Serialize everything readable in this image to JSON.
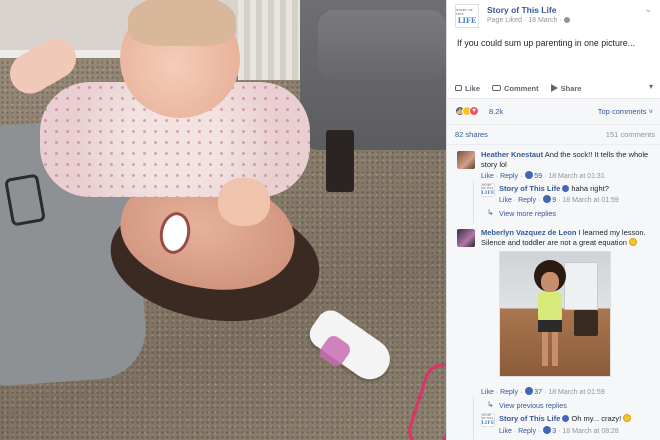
{
  "post": {
    "page_name": "Story of This Life",
    "avatar_line1": "STORY OF THIS",
    "avatar_line2": "LIFE",
    "meta": "Page Liked · 18 March ·",
    "text": "If you could sum up parenting in one picture...",
    "actions": {
      "like": "Like",
      "comment": "Comment",
      "share": "Share"
    }
  },
  "reactions": {
    "count": "8.2k",
    "top_comments": "Top comments ˅"
  },
  "stats": {
    "shares": "82 shares",
    "comments": "151 comments"
  },
  "comments": [
    {
      "author": "Heather Knestaut",
      "text_line1": "And the sock!! It tells the whole",
      "text_line2": "story lol",
      "like": "Like",
      "reply": "Reply",
      "likes": "59",
      "time": "18 March at 01:31",
      "reply_item": {
        "author": "Story of This Life",
        "text": "haha right?",
        "like": "Like",
        "reply": "Reply",
        "likes": "9",
        "time": "18 March at 01:59"
      },
      "more_replies": "View more replies"
    },
    {
      "author": "Meberlyn Vazquez de Leon",
      "text_line1": "I learned my lesson.",
      "text_line2": "Silence and toddler are not a great equation",
      "like": "Like",
      "reply": "Reply",
      "likes": "37",
      "time": "18 March at 01:59",
      "prev_replies": "View previous replies",
      "reply_item": {
        "author": "Story of This Life",
        "text": "Oh my... crazy!",
        "like": "Like",
        "reply": "Reply",
        "likes": "3",
        "time": "18 March at 08:28"
      }
    }
  ],
  "separator": "·",
  "icons": {
    "like": "thumbs-up-icon",
    "comment": "comment-bubble-icon",
    "share": "share-arrow-icon",
    "globe": "globe-icon",
    "chevron": "chevron-down-icon",
    "verified": "verified-badge-icon",
    "emoji": "laughing-emoji-icon",
    "reply_arrow": "reply-arrow-icon"
  },
  "colors": {
    "link": "#365899",
    "meta": "#90949c",
    "like_blue": "#4267b2",
    "panel_bg": "#f6f7f9"
  }
}
